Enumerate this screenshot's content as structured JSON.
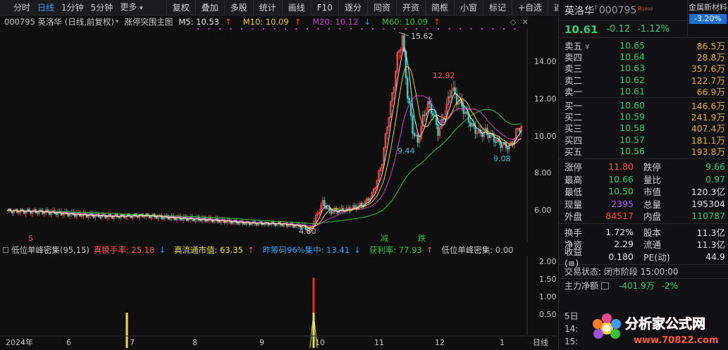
{
  "toolbar": {
    "tabs": [
      "分时",
      "日线",
      "1分钟",
      "5分钟",
      "更多"
    ],
    "active_tab": 1,
    "tools": [
      "复权",
      "叠加",
      "多股",
      "统计",
      "画线",
      "F10",
      "逐分",
      "同资",
      "开资",
      "简框",
      "小窗",
      "标记",
      "+自选",
      "返回"
    ]
  },
  "chart": {
    "code_title": "000795 英洛华 (日线,前复权)",
    "indicator_name": "涨停突围主图",
    "ma": [
      {
        "label": "M5: 10.53",
        "color": "#e8e8e8"
      },
      {
        "label": "M10: 10.09",
        "color": "#e8d030"
      },
      {
        "label": "M20: 10.12",
        "color": "#d040d0"
      },
      {
        "label": "M60: 10.09",
        "color": "#3cc040"
      }
    ],
    "y_ticks": [
      "14.00",
      "12.00",
      "10.00",
      "8.00",
      "6.00"
    ],
    "price_labels": {
      "high": "15.62",
      "mid_high": "12.92",
      "low1": "9.44",
      "low2": "9.08",
      "bottom": "4.80"
    },
    "signals": {
      "s": "S",
      "jian": "减",
      "die": "跌"
    },
    "x_labels": [
      "2024年",
      "6",
      "7",
      "8",
      "9",
      "10",
      "11",
      "12",
      "1"
    ],
    "period_btn": "日线",
    "indicator": {
      "title": "低位单峰密集(95,15)",
      "items": [
        {
          "label": "真换手率: 25.18",
          "color": "#ff5a5a",
          "arrow": "↓",
          "arrow_color": "#3c9df0"
        },
        {
          "label": "真流通市值: 63.35",
          "color": "#e8e04a",
          "arrow": "↑",
          "arrow_color": "#ff4a4a"
        },
        {
          "label": "昨筹码96%集中: 13.41",
          "color": "#3c9df0",
          "arrow": "↓",
          "arrow_color": "#3c9df0"
        },
        {
          "label": "获利率: 77.93",
          "color": "#3cc040",
          "arrow": "↑",
          "arrow_color": "#ff4a4a"
        },
        {
          "label": "低位单峰密集: 0.00",
          "color": "#c8c8c8",
          "arrow": "",
          "arrow_color": "#c8c8c8"
        }
      ],
      "y_ticks": [
        "2.00",
        "1.50",
        "1.00",
        "0.50"
      ]
    }
  },
  "quote": {
    "name": "英洛华",
    "code": "000795",
    "r_badge": "R",
    "sector": "金属新材料",
    "sector_pct": "-3.20%",
    "price": "10.61",
    "change": "-0.12",
    "change_pct": "-1.12%",
    "sells": [
      {
        "label": "卖五",
        "price": "10.65",
        "vol": "86.5万"
      },
      {
        "label": "卖四",
        "price": "10.64",
        "vol": "28.8万"
      },
      {
        "label": "卖三",
        "price": "10.63",
        "vol": "357.6万"
      },
      {
        "label": "卖二",
        "price": "10.62",
        "vol": "122.7万"
      },
      {
        "label": "卖一",
        "price": "10.61",
        "vol": "66.9万"
      }
    ],
    "buys": [
      {
        "label": "买一",
        "price": "10.60",
        "vol": "146.6万"
      },
      {
        "label": "买二",
        "price": "10.59",
        "vol": "241.9万"
      },
      {
        "label": "买三",
        "price": "10.58",
        "vol": "407.4万"
      },
      {
        "label": "买四",
        "price": "10.57",
        "vol": "181.1万"
      },
      {
        "label": "买五",
        "price": "10.56",
        "vol": "193.8万"
      }
    ],
    "stats1": [
      {
        "k1": "涨停",
        "v1": "11.80",
        "c1": "red",
        "k2": "跌停",
        "v2": "9.66",
        "c2": "green"
      },
      {
        "k1": "最高",
        "v1": "10.66",
        "c1": "green",
        "k2": "量比",
        "v2": "0.97",
        "c2": "green"
      },
      {
        "k1": "最低",
        "v1": "10.50",
        "c1": "green",
        "k2": "市值",
        "v2": "120.3亿",
        "c2": "white"
      },
      {
        "k1": "现量",
        "v1": "2395",
        "c1": "purple",
        "k2": "总量",
        "v2": "195304",
        "c2": "white"
      },
      {
        "k1": "外盘",
        "v1": "84517",
        "c1": "red",
        "k2": "内盘",
        "v2": "110787",
        "c2": "green"
      }
    ],
    "stats2": [
      {
        "k1": "换手",
        "v1": "1.72%",
        "c1": "white",
        "k2": "股本",
        "v2": "11.3亿",
        "c2": "white"
      },
      {
        "k1": "净资",
        "v1": "2.29",
        "c1": "white",
        "k2": "流通",
        "v2": "11.3亿",
        "c2": "white"
      },
      {
        "k1": "收益(≡)",
        "v1": "0.180",
        "c1": "white",
        "k2": "PE(动)",
        "v2": "44.9",
        "c2": "white"
      }
    ],
    "trade_state": "交易状态: 闭市阶段 15:00:00",
    "flow_label": "主力净额",
    "flow_value": "-401.9万",
    "flow_pct": "-2%",
    "day_line1": "5日",
    "day_line2": "14:",
    "day_line3": "15:",
    "watermark_text": "分析家公式网",
    "watermark_url": "www.70822.com"
  }
}
